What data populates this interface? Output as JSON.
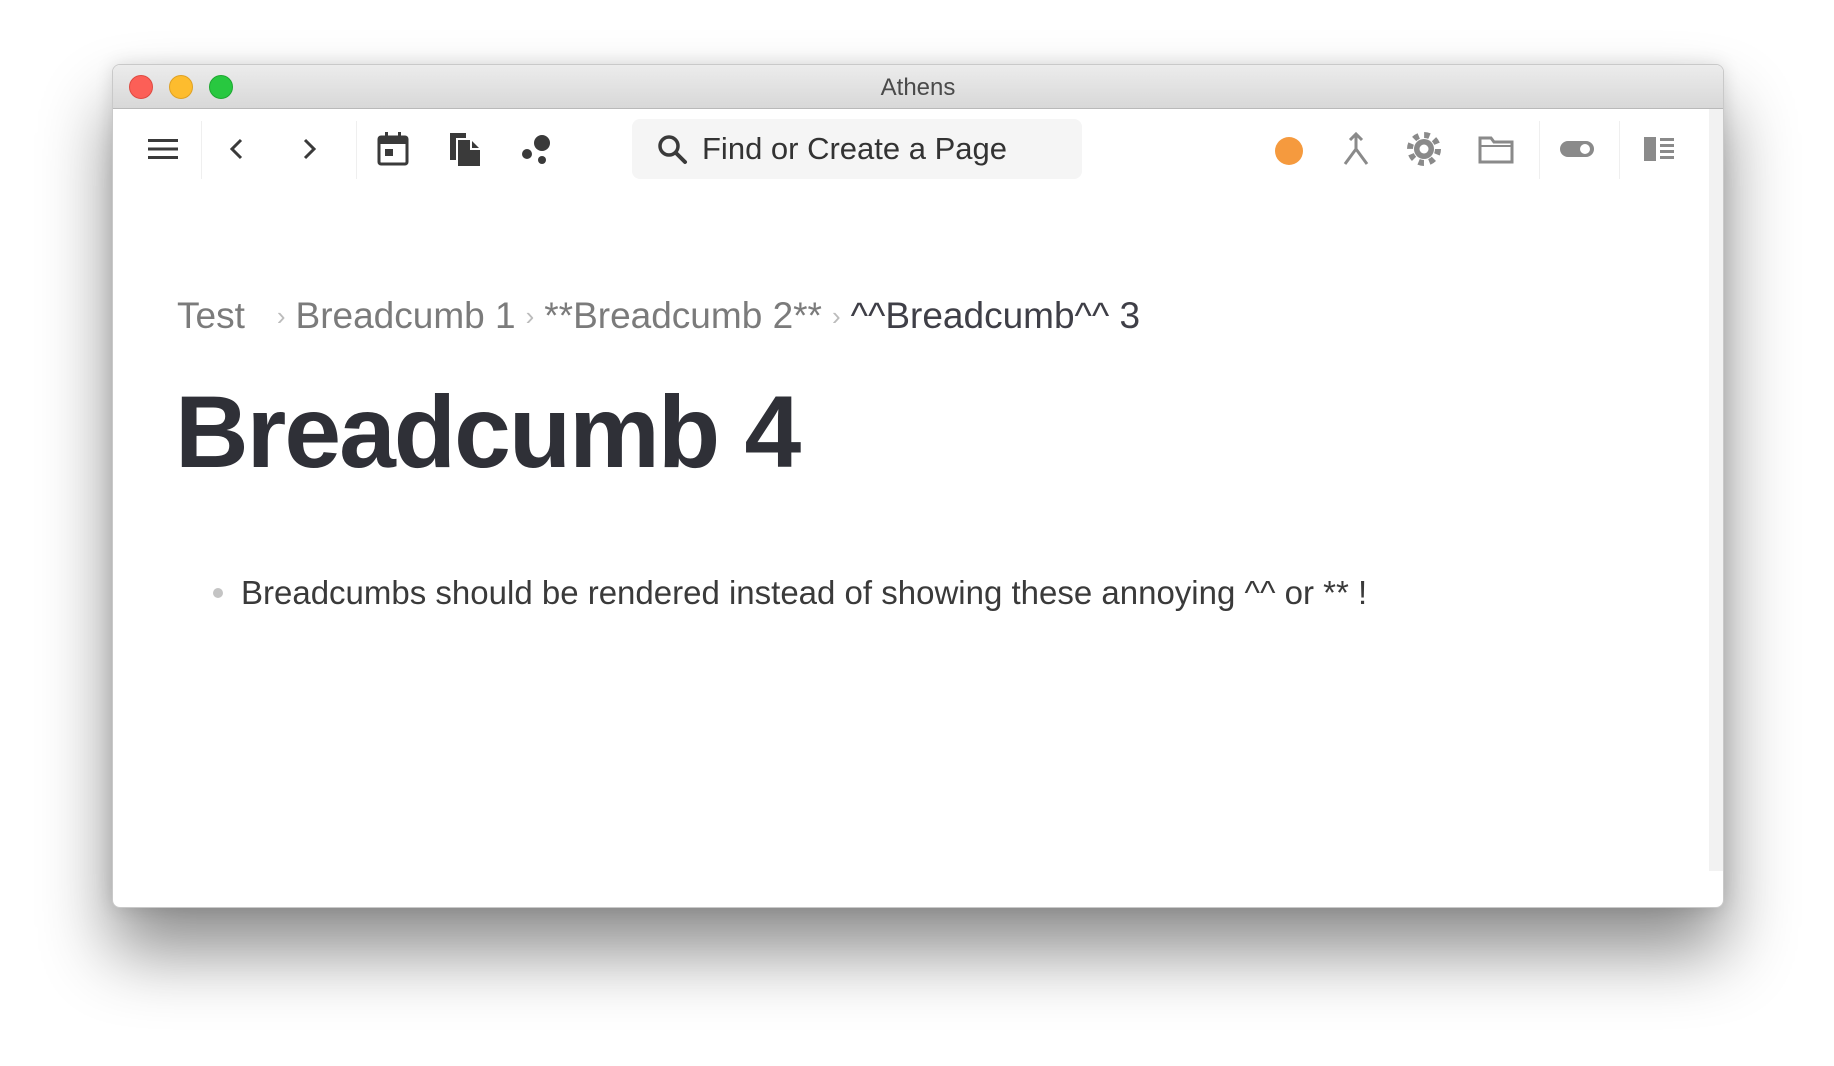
{
  "window": {
    "title": "Athens"
  },
  "toolbar": {
    "buttons": [
      {
        "name": "menu-icon"
      },
      {
        "name": "chevron-left-icon"
      },
      {
        "name": "chevron-right-icon"
      },
      {
        "name": "calendar-icon"
      },
      {
        "name": "pages-icon"
      },
      {
        "name": "graph-icon"
      },
      {
        "name": "merge-icon"
      },
      {
        "name": "gear-icon"
      },
      {
        "name": "folder-icon"
      },
      {
        "name": "toggle-icon"
      },
      {
        "name": "right-sidebar-icon"
      }
    ],
    "search": {
      "placeholder": "Find or Create a Page"
    },
    "status_color": "#f59a3e"
  },
  "page": {
    "breadcrumbs": [
      "Test",
      "Breadcumb 1",
      "**Breadcumb 2**",
      "^^Breadcumb^^ 3"
    ],
    "title": "Breadcumb 4",
    "blocks": [
      "Breadcumbs should be rendered instead of showing these annoying ^^ or ** !"
    ]
  }
}
